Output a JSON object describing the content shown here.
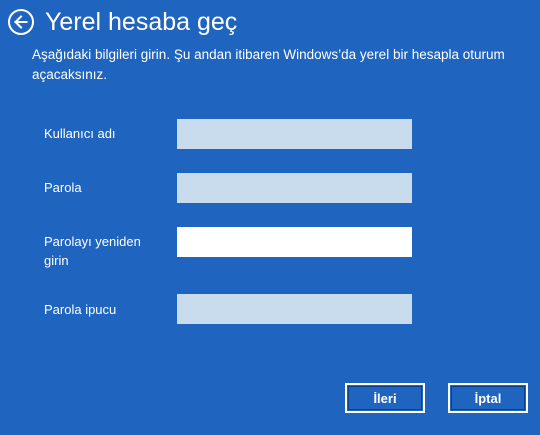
{
  "header": {
    "back_icon": "arrow-left-circle-icon",
    "title": "Yerel hesaba geç"
  },
  "description": "Aşağıdaki bilgileri girin. Şu andan itibaren Windows’da yerel bir hesapla oturum açacaksınız.",
  "form": {
    "username_label": "Kullanıcı adı",
    "username_value": "",
    "password_label": "Parola",
    "password_value": "",
    "password_confirm_label": "Parolayı yeniden girin",
    "password_confirm_value": "",
    "password_hint_label": "Parola ipucu",
    "password_hint_value": ""
  },
  "buttons": {
    "next_label": "İleri",
    "cancel_label": "İptal"
  },
  "colors": {
    "background": "#1f64be",
    "input_background": "#c9dcee",
    "focused_input_background": "#ffffff",
    "text": "#ffffff"
  }
}
